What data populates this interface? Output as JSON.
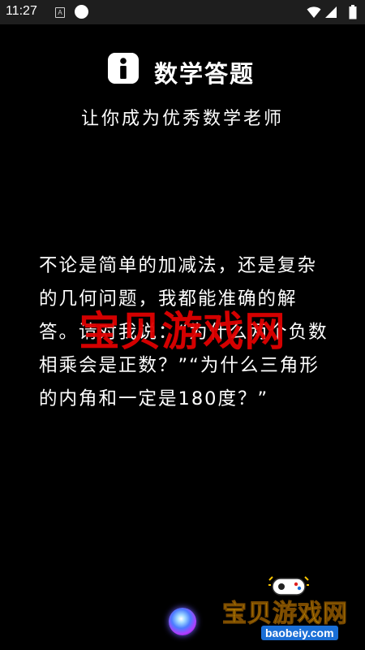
{
  "status_bar": {
    "time": "11:27",
    "a_icon_letter": "A",
    "icons": [
      "a-notification-icon",
      "circle-notification-icon",
      "wifi-icon",
      "signal-icon",
      "battery-icon"
    ]
  },
  "header": {
    "title": "数学答题",
    "icon": "info-icon"
  },
  "subtitle": "让你成为优秀数学老师",
  "body_text": "不论是简单的加减法，还是复杂的几何问题，我都能准确的解答。请对我说：“为什么两个负数相乘会是正数？”“为什么三角形的内角和一定是180度？”",
  "watermark": "宝贝游戏网",
  "logo": {
    "text": "宝贝游戏网",
    "url": "baobeiy.com"
  },
  "voice_button": {
    "icon": "voice-assistant-orb-icon"
  },
  "colors": {
    "background": "#000000",
    "status_bar": "#1e1e1e",
    "text": "#ffffff",
    "watermark": "#e00000",
    "logo_yellow": "#f7c400",
    "logo_blue": "#1a6fd6"
  }
}
